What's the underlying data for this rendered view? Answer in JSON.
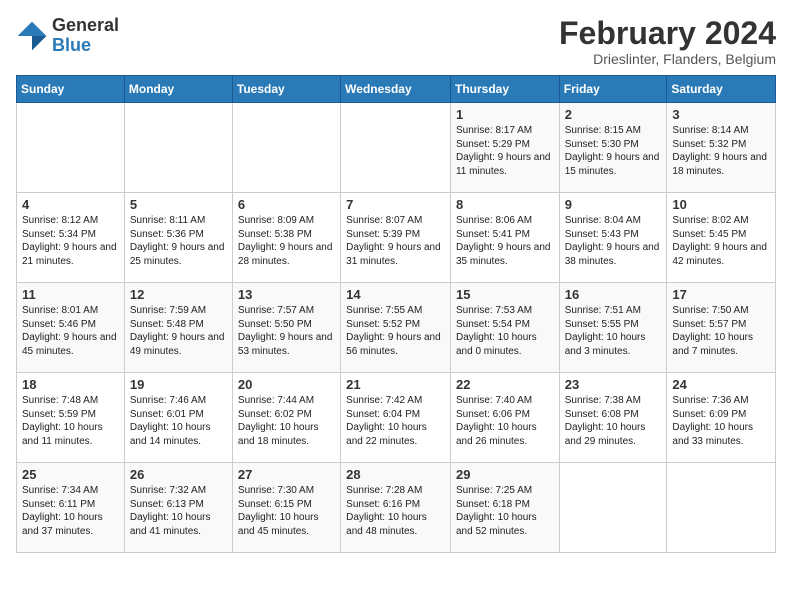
{
  "logo": {
    "line1": "General",
    "line2": "Blue"
  },
  "calendar": {
    "title": "February 2024",
    "subtitle": "Drieslinter, Flanders, Belgium",
    "weekdays": [
      "Sunday",
      "Monday",
      "Tuesday",
      "Wednesday",
      "Thursday",
      "Friday",
      "Saturday"
    ],
    "weeks": [
      [
        {
          "day": "",
          "info": ""
        },
        {
          "day": "",
          "info": ""
        },
        {
          "day": "",
          "info": ""
        },
        {
          "day": "",
          "info": ""
        },
        {
          "day": "1",
          "info": "Sunrise: 8:17 AM\nSunset: 5:29 PM\nDaylight: 9 hours\nand 11 minutes."
        },
        {
          "day": "2",
          "info": "Sunrise: 8:15 AM\nSunset: 5:30 PM\nDaylight: 9 hours\nand 15 minutes."
        },
        {
          "day": "3",
          "info": "Sunrise: 8:14 AM\nSunset: 5:32 PM\nDaylight: 9 hours\nand 18 minutes."
        }
      ],
      [
        {
          "day": "4",
          "info": "Sunrise: 8:12 AM\nSunset: 5:34 PM\nDaylight: 9 hours\nand 21 minutes."
        },
        {
          "day": "5",
          "info": "Sunrise: 8:11 AM\nSunset: 5:36 PM\nDaylight: 9 hours\nand 25 minutes."
        },
        {
          "day": "6",
          "info": "Sunrise: 8:09 AM\nSunset: 5:38 PM\nDaylight: 9 hours\nand 28 minutes."
        },
        {
          "day": "7",
          "info": "Sunrise: 8:07 AM\nSunset: 5:39 PM\nDaylight: 9 hours\nand 31 minutes."
        },
        {
          "day": "8",
          "info": "Sunrise: 8:06 AM\nSunset: 5:41 PM\nDaylight: 9 hours\nand 35 minutes."
        },
        {
          "day": "9",
          "info": "Sunrise: 8:04 AM\nSunset: 5:43 PM\nDaylight: 9 hours\nand 38 minutes."
        },
        {
          "day": "10",
          "info": "Sunrise: 8:02 AM\nSunset: 5:45 PM\nDaylight: 9 hours\nand 42 minutes."
        }
      ],
      [
        {
          "day": "11",
          "info": "Sunrise: 8:01 AM\nSunset: 5:46 PM\nDaylight: 9 hours\nand 45 minutes."
        },
        {
          "day": "12",
          "info": "Sunrise: 7:59 AM\nSunset: 5:48 PM\nDaylight: 9 hours\nand 49 minutes."
        },
        {
          "day": "13",
          "info": "Sunrise: 7:57 AM\nSunset: 5:50 PM\nDaylight: 9 hours\nand 53 minutes."
        },
        {
          "day": "14",
          "info": "Sunrise: 7:55 AM\nSunset: 5:52 PM\nDaylight: 9 hours\nand 56 minutes."
        },
        {
          "day": "15",
          "info": "Sunrise: 7:53 AM\nSunset: 5:54 PM\nDaylight: 10 hours\nand 0 minutes."
        },
        {
          "day": "16",
          "info": "Sunrise: 7:51 AM\nSunset: 5:55 PM\nDaylight: 10 hours\nand 3 minutes."
        },
        {
          "day": "17",
          "info": "Sunrise: 7:50 AM\nSunset: 5:57 PM\nDaylight: 10 hours\nand 7 minutes."
        }
      ],
      [
        {
          "day": "18",
          "info": "Sunrise: 7:48 AM\nSunset: 5:59 PM\nDaylight: 10 hours\nand 11 minutes."
        },
        {
          "day": "19",
          "info": "Sunrise: 7:46 AM\nSunset: 6:01 PM\nDaylight: 10 hours\nand 14 minutes."
        },
        {
          "day": "20",
          "info": "Sunrise: 7:44 AM\nSunset: 6:02 PM\nDaylight: 10 hours\nand 18 minutes."
        },
        {
          "day": "21",
          "info": "Sunrise: 7:42 AM\nSunset: 6:04 PM\nDaylight: 10 hours\nand 22 minutes."
        },
        {
          "day": "22",
          "info": "Sunrise: 7:40 AM\nSunset: 6:06 PM\nDaylight: 10 hours\nand 26 minutes."
        },
        {
          "day": "23",
          "info": "Sunrise: 7:38 AM\nSunset: 6:08 PM\nDaylight: 10 hours\nand 29 minutes."
        },
        {
          "day": "24",
          "info": "Sunrise: 7:36 AM\nSunset: 6:09 PM\nDaylight: 10 hours\nand 33 minutes."
        }
      ],
      [
        {
          "day": "25",
          "info": "Sunrise: 7:34 AM\nSunset: 6:11 PM\nDaylight: 10 hours\nand 37 minutes."
        },
        {
          "day": "26",
          "info": "Sunrise: 7:32 AM\nSunset: 6:13 PM\nDaylight: 10 hours\nand 41 minutes."
        },
        {
          "day": "27",
          "info": "Sunrise: 7:30 AM\nSunset: 6:15 PM\nDaylight: 10 hours\nand 45 minutes."
        },
        {
          "day": "28",
          "info": "Sunrise: 7:28 AM\nSunset: 6:16 PM\nDaylight: 10 hours\nand 48 minutes."
        },
        {
          "day": "29",
          "info": "Sunrise: 7:25 AM\nSunset: 6:18 PM\nDaylight: 10 hours\nand 52 minutes."
        },
        {
          "day": "",
          "info": ""
        },
        {
          "day": "",
          "info": ""
        }
      ]
    ]
  }
}
